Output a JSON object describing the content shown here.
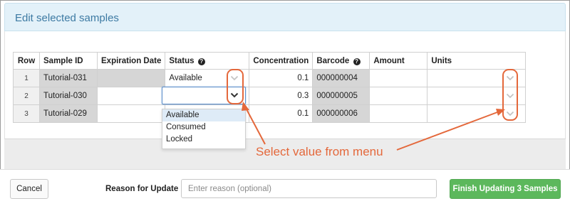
{
  "dialog": {
    "title": "Edit selected samples"
  },
  "grid": {
    "columns": [
      "Row",
      "Sample ID",
      "Expiration Date",
      "Status",
      "Concentration",
      "Barcode",
      "Amount",
      "Units"
    ],
    "help_icon_glyph": "?",
    "rows": [
      {
        "row": "1",
        "sample_id": "Tutorial-031",
        "expiration_date": "",
        "status": "Available",
        "concentration": "0.1",
        "barcode": "000000004",
        "amount": "",
        "units": ""
      },
      {
        "row": "2",
        "sample_id": "Tutorial-030",
        "expiration_date": "",
        "status": "",
        "concentration": "0.3",
        "barcode": "000000005",
        "amount": "",
        "units": ""
      },
      {
        "row": "3",
        "sample_id": "Tutorial-029",
        "expiration_date": "",
        "status": "",
        "concentration": "0.1",
        "barcode": "000000006",
        "amount": "",
        "units": ""
      }
    ]
  },
  "status_menu": {
    "options": [
      "Available",
      "Consumed",
      "Locked"
    ],
    "highlighted": "Available"
  },
  "annotation": {
    "callout": "Select value from menu",
    "color": "#e4683b"
  },
  "footer": {
    "cancel_label": "Cancel",
    "reason_label": "Reason for Update",
    "reason_placeholder": "Enter reason (optional)",
    "finish_label": "Finish Updating 3 Samples"
  },
  "colors": {
    "header_bg": "#e3f1f9",
    "title": "#3d7aa3",
    "readonly_cell": "#d6d6d6",
    "finish_button": "#5cb85c",
    "focus_border": "#5b8ec9"
  }
}
